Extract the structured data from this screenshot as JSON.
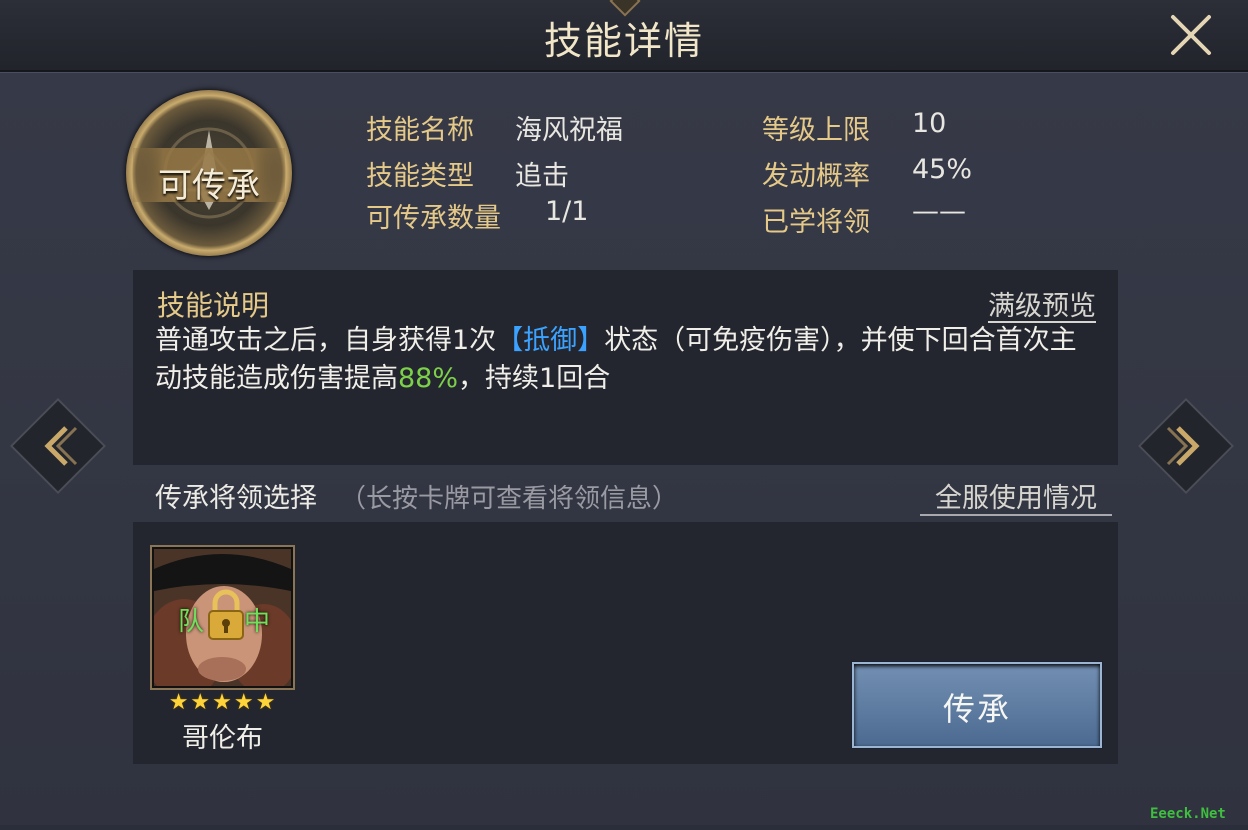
{
  "header": {
    "title": "技能详情",
    "close_icon": "close-icon"
  },
  "medal": {
    "label": "可传承",
    "icon": "sword-emblem-icon"
  },
  "info": {
    "skill_name_label": "技能名称",
    "skill_name_value": "海风祝福",
    "skill_type_label": "技能类型",
    "skill_type_value": "追击",
    "inherit_count_label": "可传承数量",
    "inherit_count_value": "1/1",
    "level_cap_label": "等级上限",
    "level_cap_value": "10",
    "trigger_rate_label": "发动概率",
    "trigger_rate_value": "45%",
    "learned_by_label": "已学将领",
    "learned_by_value": "——"
  },
  "description": {
    "title": "技能说明",
    "preview_link": "满级预览",
    "text_part1": "普通攻击之后，自身获得1次",
    "keyword": "【抵御】",
    "text_part2": "状态（可免疫伤害），并使下回合首次主动技能造成伤害提高",
    "value": "88%",
    "text_part3": "，持续1回合"
  },
  "inherit": {
    "title": "传承将领选择",
    "hint": "（长按卡牌可查看将领信息）",
    "server_usage_link": "全服使用情况",
    "button_label": "传承"
  },
  "hero": {
    "name": "哥伦布",
    "stars": "★★★★★",
    "star_count": 5,
    "status_left": "队",
    "status_right": "中"
  },
  "watermark": "Eeeck.Net",
  "colors": {
    "gold_label": "#e5c989",
    "keyword_blue": "#3ba3ff",
    "value_green": "#7dd04a",
    "star_yellow": "#ffd43a",
    "button_blue": "#5e7ca3"
  }
}
